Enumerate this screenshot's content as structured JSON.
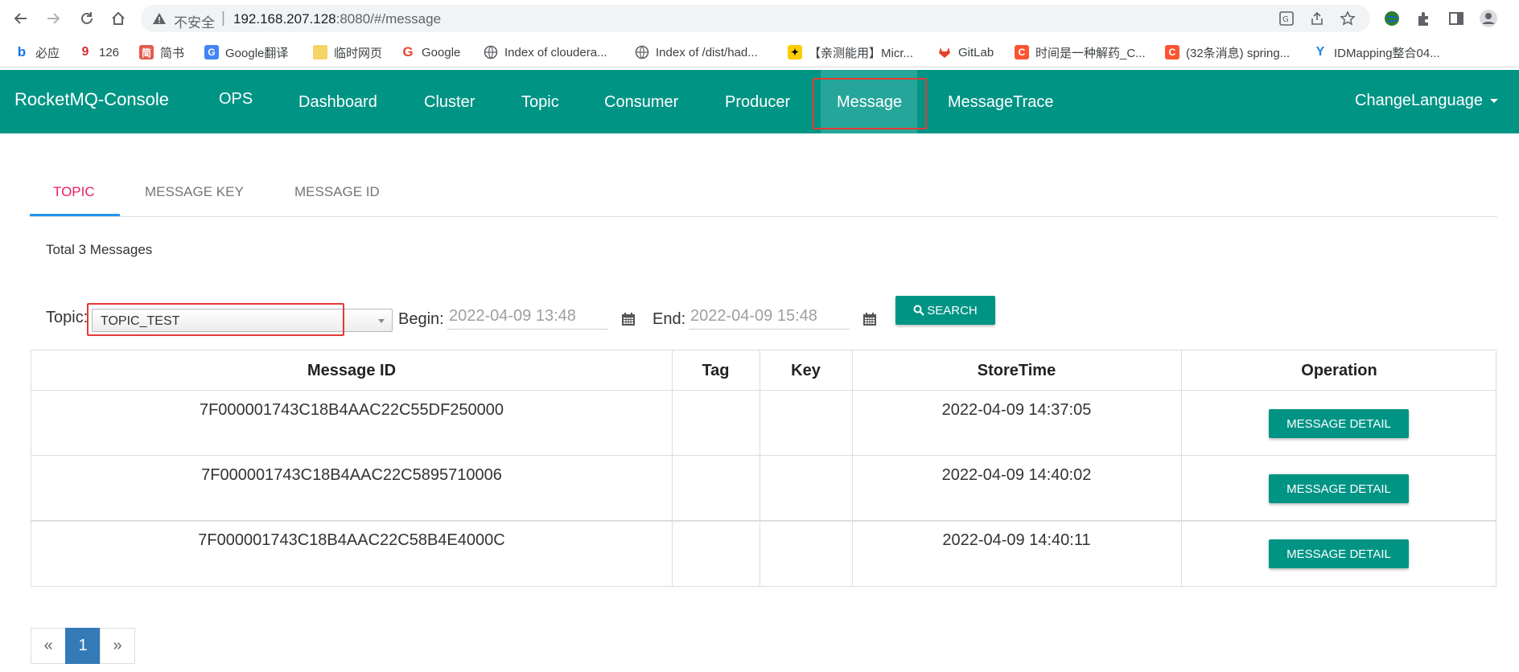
{
  "browser": {
    "insecure_label": "不安全",
    "separator": "|",
    "url_host": "192.168.207.128",
    "url_path": ":8080/#/message",
    "bookmarks": [
      {
        "label": "必应",
        "icon": "bing-icon"
      },
      {
        "label": "126",
        "icon": "netease-icon"
      },
      {
        "label": "简书",
        "icon": "jianshu-icon"
      },
      {
        "label": "Google翻译",
        "icon": "google-translate-icon"
      },
      {
        "label": "临时网页",
        "icon": "folder-icon"
      },
      {
        "label": "Google",
        "icon": "google-icon"
      },
      {
        "label": "Index of cloudera...",
        "icon": "globe-icon"
      },
      {
        "label": "Index of /dist/had...",
        "icon": "globe-icon"
      },
      {
        "label": "【亲测能用】Micr...",
        "icon": "bookmark-yellow-icon"
      },
      {
        "label": "GitLab",
        "icon": "gitlab-icon"
      },
      {
        "label": "时间是一种解药_C...",
        "icon": "csdn-icon"
      },
      {
        "label": "(32条消息) spring...",
        "icon": "csdn-icon"
      },
      {
        "label": "IDMapping整合04...",
        "icon": "y-icon"
      }
    ]
  },
  "app": {
    "brand": "RocketMQ-Console",
    "nav": [
      "OPS",
      "Dashboard",
      "Cluster",
      "Topic",
      "Consumer",
      "Producer",
      "Message",
      "MessageTrace"
    ],
    "active_nav": "Message",
    "change_language": "ChangeLanguage"
  },
  "tabs": [
    "TOPIC",
    "MESSAGE KEY",
    "MESSAGE ID"
  ],
  "active_tab": "TOPIC",
  "total_label": "Total 3 Messages",
  "filter": {
    "topic_label": "Topic:",
    "topic_value": "TOPIC_TEST",
    "begin_label": "Begin:",
    "begin_value": "2022-04-09 13:48",
    "end_label": "End:",
    "end_value": "2022-04-09 15:48",
    "search_label": "SEARCH"
  },
  "table": {
    "headers": [
      "Message ID",
      "Tag",
      "Key",
      "StoreTime",
      "Operation"
    ],
    "rows": [
      {
        "message_id": "7F000001743C18B4AAC22C55DF250000",
        "tag": "",
        "key": "",
        "store_time": "2022-04-09 14:37:05",
        "action": "MESSAGE DETAIL"
      },
      {
        "message_id": "7F000001743C18B4AAC22C5895710006",
        "tag": "",
        "key": "",
        "store_time": "2022-04-09 14:40:02",
        "action": "MESSAGE DETAIL"
      },
      {
        "message_id": "7F000001743C18B4AAC22C58B4E4000C",
        "tag": "",
        "key": "",
        "store_time": "2022-04-09 14:40:11",
        "action": "MESSAGE DETAIL"
      }
    ]
  },
  "pagination": {
    "prev": "«",
    "current": "1",
    "next": "»"
  },
  "colors": {
    "primary": "#009485",
    "active_tab": "#e91e63",
    "highlight_box": "#e53935",
    "pager_active": "#337ab7"
  }
}
